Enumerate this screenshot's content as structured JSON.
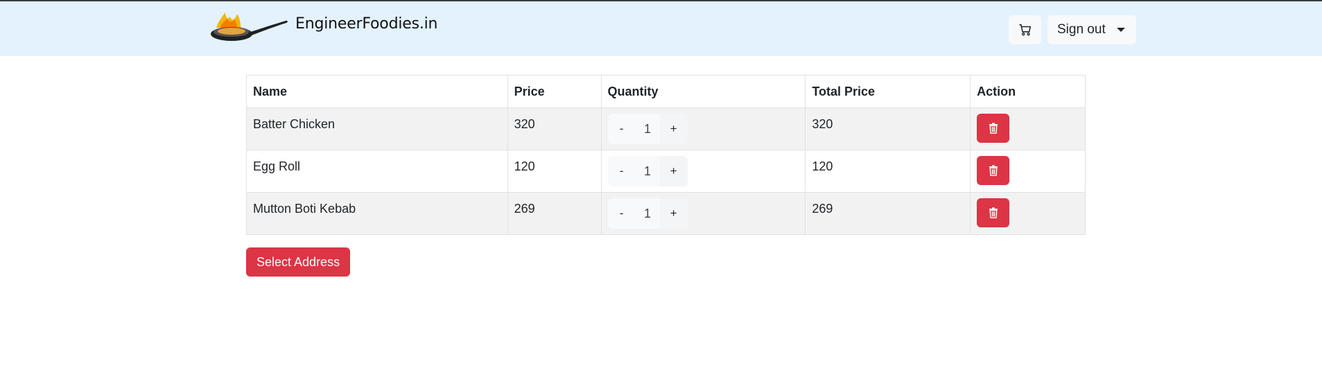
{
  "header": {
    "brand": "EngineerFoodies.in",
    "cart_icon": "cart-icon",
    "signout_label": "Sign out",
    "dropdown_icon": "caret-down-icon",
    "background": "#e3f2fd"
  },
  "cart": {
    "columns": [
      "Name",
      "Price",
      "Quantity",
      "Total Price",
      "Action"
    ],
    "items": [
      {
        "name": "Batter Chicken",
        "price": "320",
        "quantity": "1",
        "total": "320"
      },
      {
        "name": "Egg Roll",
        "price": "120",
        "quantity": "1",
        "total": "120"
      },
      {
        "name": "Mutton Boti Kebab",
        "price": "269",
        "quantity": "1",
        "total": "269"
      }
    ],
    "decrement_label": "-",
    "increment_label": "+",
    "delete_icon": "trash-icon"
  },
  "actions": {
    "select_address_label": "Select Address"
  },
  "colors": {
    "danger": "#dc3545",
    "light": "#f8f9fa",
    "stripe": "#f2f2f2"
  }
}
